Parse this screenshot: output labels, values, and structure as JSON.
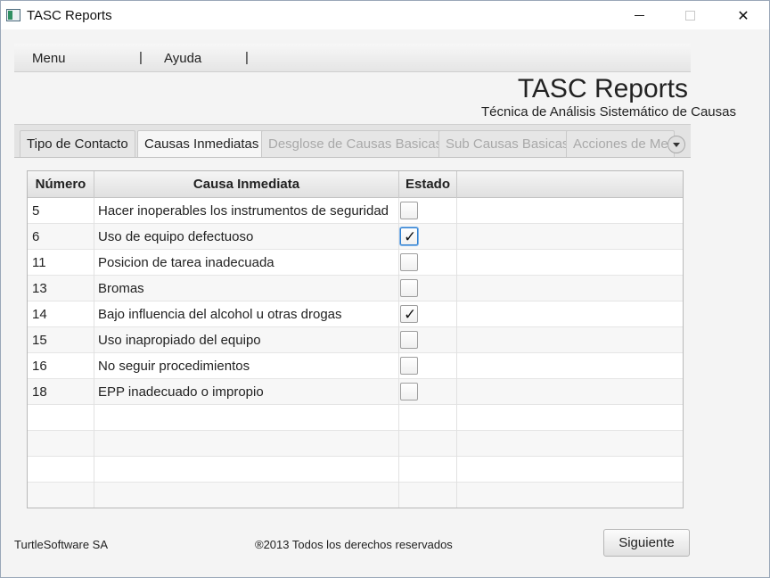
{
  "window": {
    "title": "TASC Reports",
    "controls": {
      "minimize": "minimize-icon",
      "maximize": "maximize-icon",
      "close": "close-icon",
      "close_glyph": "✕"
    }
  },
  "menu": {
    "items": [
      "Menu",
      "Ayuda"
    ],
    "separator": "|"
  },
  "header": {
    "title": "TASC Reports",
    "subtitle": "Técnica de Análisis Sistemático de Causas"
  },
  "tabs": [
    {
      "label": "Tipo de Contacto",
      "state": "normal"
    },
    {
      "label": "Causas Inmediatas",
      "state": "active"
    },
    {
      "label": "Desglose de Causas Basicas",
      "state": "disabled"
    },
    {
      "label": "Sub Causas Basicas",
      "state": "disabled"
    },
    {
      "label": "Acciones de Me",
      "state": "disabled"
    }
  ],
  "table": {
    "columns": [
      "Número",
      "Causa Inmediata",
      "Estado",
      ""
    ],
    "rows": [
      {
        "numero": "5",
        "causa": "Hacer inoperables los instrumentos de seguridad",
        "checked": false,
        "focused": false,
        "check_glyph": ""
      },
      {
        "numero": "6",
        "causa": "Uso de equipo defectuoso",
        "checked": true,
        "focused": true,
        "check_glyph": "✓"
      },
      {
        "numero": "11",
        "causa": "Posicion de tarea inadecuada",
        "checked": false,
        "focused": false,
        "check_glyph": ""
      },
      {
        "numero": "13",
        "causa": "Bromas",
        "checked": false,
        "focused": false,
        "check_glyph": ""
      },
      {
        "numero": "14",
        "causa": "Bajo influencia del alcohol u otras drogas",
        "checked": true,
        "focused": false,
        "check_glyph": "✓"
      },
      {
        "numero": "15",
        "causa": "Uso inapropiado del equipo",
        "checked": false,
        "focused": false,
        "check_glyph": ""
      },
      {
        "numero": "16",
        "causa": "No seguir procedimientos",
        "checked": false,
        "focused": false,
        "check_glyph": ""
      },
      {
        "numero": "18",
        "causa": "EPP inadecuado o impropio",
        "checked": false,
        "focused": false,
        "check_glyph": ""
      }
    ]
  },
  "footer": {
    "company": "TurtleSoftware SA",
    "copyright": "®2013 Todos los derechos reservados",
    "next_button": "Siguiente"
  },
  "colors": {
    "focus_blue": "#2f7fcf",
    "disabled_text": "#a9a9a9",
    "background": "#f4f4f4"
  }
}
